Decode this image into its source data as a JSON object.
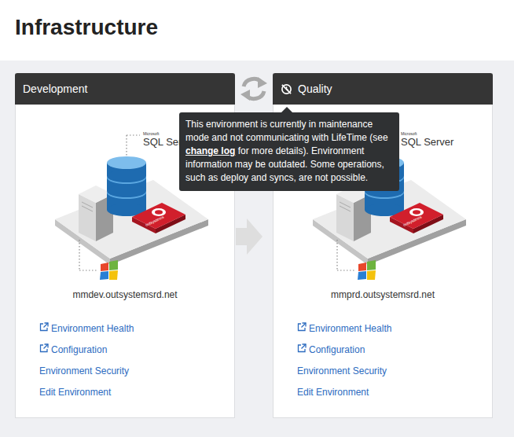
{
  "page": {
    "title": "Infrastructure"
  },
  "environments": [
    {
      "name": "Development",
      "maintenance": false,
      "hostname": "mmdev.outsystemsrd.net",
      "diagram": {
        "db_vendor": "Microsoft",
        "db_label": "SQL Server",
        "platform_label": "outsystems"
      },
      "links": [
        {
          "label": "Environment Health",
          "external": true
        },
        {
          "label": "Configuration",
          "external": true
        },
        {
          "label": "Environment Security",
          "external": false
        },
        {
          "label": "Edit Environment",
          "external": false
        }
      ]
    },
    {
      "name": "Quality",
      "maintenance": true,
      "hostname": "mmprd.outsystemsrd.net",
      "diagram": {
        "db_vendor": "Microsoft",
        "db_label": "SQL Server",
        "platform_label": "outsystems"
      },
      "links": [
        {
          "label": "Environment Health",
          "external": true
        },
        {
          "label": "Configuration",
          "external": true
        },
        {
          "label": "Environment Security",
          "external": false
        },
        {
          "label": "Edit Environment",
          "external": false
        }
      ]
    }
  ],
  "tooltip": {
    "visible": true,
    "before": "This environment is currently in maintenance mode and not communicating with LifeTime (see ",
    "link": "change log",
    "after": " for more details). Environment information may be outdated. Some operations, such as deploy and syncs, are not possible."
  }
}
